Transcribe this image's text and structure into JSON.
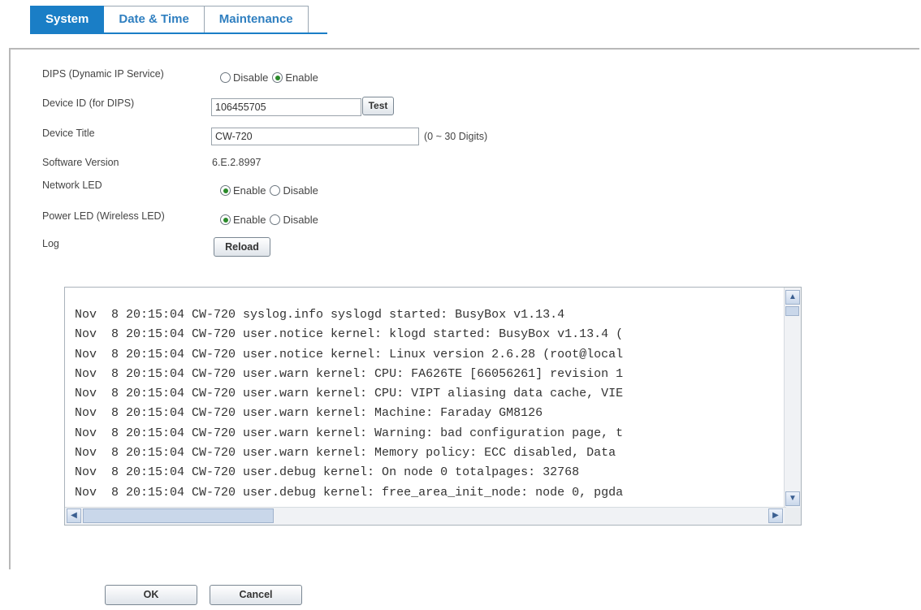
{
  "tabs": [
    {
      "label": "System",
      "active": true
    },
    {
      "label": "Date & Time",
      "active": false
    },
    {
      "label": "Maintenance",
      "active": false
    }
  ],
  "fields": {
    "dips": {
      "label": "DIPS (Dynamic IP Service)",
      "options": [
        "Disable",
        "Enable"
      ],
      "selected": "Enable"
    },
    "device_id": {
      "label": "Device ID (for DIPS)",
      "value": "106455705",
      "button": "Test"
    },
    "device_title": {
      "label": "Device Title",
      "value": "CW-720",
      "hint": "(0 ~ 30 Digits)"
    },
    "software_version": {
      "label": "Software Version",
      "value": "6.E.2.8997"
    },
    "network_led": {
      "label": "Network LED",
      "options": [
        "Enable",
        "Disable"
      ],
      "selected": "Enable"
    },
    "power_led": {
      "label": "Power LED (Wireless LED)",
      "options": [
        "Enable",
        "Disable"
      ],
      "selected": "Enable"
    },
    "log": {
      "label": "Log",
      "button": "Reload"
    }
  },
  "log_lines": [
    "Nov  8 20:15:04 CW-720 syslog.info syslogd started: BusyBox v1.13.4",
    "Nov  8 20:15:04 CW-720 user.notice kernel: klogd started: BusyBox v1.13.4 (",
    "Nov  8 20:15:04 CW-720 user.notice kernel: Linux version 2.6.28 (root@local",
    "Nov  8 20:15:04 CW-720 user.warn kernel: CPU: FA626TE [66056261] revision 1",
    "Nov  8 20:15:04 CW-720 user.warn kernel: CPU: VIPT aliasing data cache, VIE",
    "Nov  8 20:15:04 CW-720 user.warn kernel: Machine: Faraday GM8126",
    "Nov  8 20:15:04 CW-720 user.warn kernel: Warning: bad configuration page, t",
    "Nov  8 20:15:04 CW-720 user.warn kernel: Memory policy: ECC disabled, Data",
    "Nov  8 20:15:04 CW-720 user.debug kernel: On node 0 totalpages: 32768",
    "Nov  8 20:15:04 CW-720 user.debug kernel: free_area_init_node: node 0, pgda"
  ],
  "footer": {
    "ok": "OK",
    "cancel": "Cancel"
  }
}
